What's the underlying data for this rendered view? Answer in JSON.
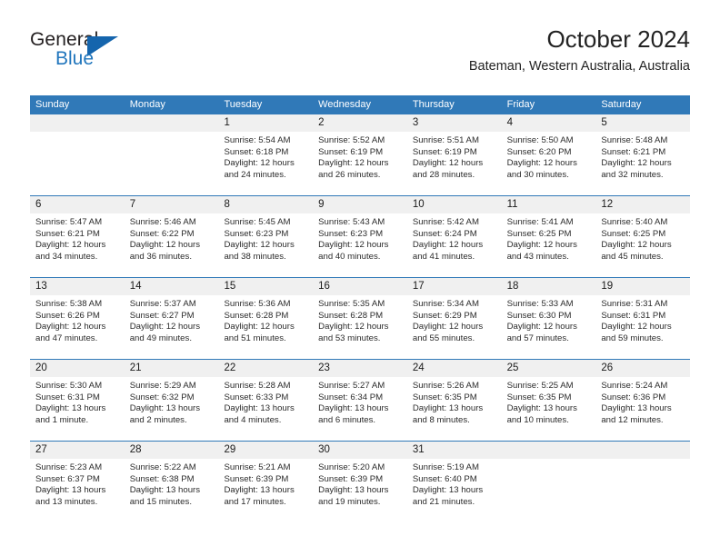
{
  "brand": {
    "name_part1": "General",
    "name_part2": "Blue",
    "triangle_color": "#1565ad",
    "blue_color": "#2176bd"
  },
  "header": {
    "title": "October 2024",
    "location": "Bateman, Western Australia, Australia"
  },
  "theme": {
    "header_blue": "#3079b8",
    "daynum_band": "#f0f0f0",
    "text": "#2b2b2b"
  },
  "weekdays": [
    "Sunday",
    "Monday",
    "Tuesday",
    "Wednesday",
    "Thursday",
    "Friday",
    "Saturday"
  ],
  "labels": {
    "sunrise_prefix": "Sunrise:",
    "sunset_prefix": "Sunset:",
    "daylight_prefix": "Daylight:"
  },
  "weeks": [
    [
      {
        "day": "",
        "empty": true
      },
      {
        "day": "",
        "empty": true
      },
      {
        "day": "1",
        "sunrise": "Sunrise: 5:54 AM",
        "sunset": "Sunset: 6:18 PM",
        "daylight_l1": "Daylight: 12 hours",
        "daylight_l2": "and 24 minutes."
      },
      {
        "day": "2",
        "sunrise": "Sunrise: 5:52 AM",
        "sunset": "Sunset: 6:19 PM",
        "daylight_l1": "Daylight: 12 hours",
        "daylight_l2": "and 26 minutes."
      },
      {
        "day": "3",
        "sunrise": "Sunrise: 5:51 AM",
        "sunset": "Sunset: 6:19 PM",
        "daylight_l1": "Daylight: 12 hours",
        "daylight_l2": "and 28 minutes."
      },
      {
        "day": "4",
        "sunrise": "Sunrise: 5:50 AM",
        "sunset": "Sunset: 6:20 PM",
        "daylight_l1": "Daylight: 12 hours",
        "daylight_l2": "and 30 minutes."
      },
      {
        "day": "5",
        "sunrise": "Sunrise: 5:48 AM",
        "sunset": "Sunset: 6:21 PM",
        "daylight_l1": "Daylight: 12 hours",
        "daylight_l2": "and 32 minutes."
      }
    ],
    [
      {
        "day": "6",
        "sunrise": "Sunrise: 5:47 AM",
        "sunset": "Sunset: 6:21 PM",
        "daylight_l1": "Daylight: 12 hours",
        "daylight_l2": "and 34 minutes."
      },
      {
        "day": "7",
        "sunrise": "Sunrise: 5:46 AM",
        "sunset": "Sunset: 6:22 PM",
        "daylight_l1": "Daylight: 12 hours",
        "daylight_l2": "and 36 minutes."
      },
      {
        "day": "8",
        "sunrise": "Sunrise: 5:45 AM",
        "sunset": "Sunset: 6:23 PM",
        "daylight_l1": "Daylight: 12 hours",
        "daylight_l2": "and 38 minutes."
      },
      {
        "day": "9",
        "sunrise": "Sunrise: 5:43 AM",
        "sunset": "Sunset: 6:23 PM",
        "daylight_l1": "Daylight: 12 hours",
        "daylight_l2": "and 40 minutes."
      },
      {
        "day": "10",
        "sunrise": "Sunrise: 5:42 AM",
        "sunset": "Sunset: 6:24 PM",
        "daylight_l1": "Daylight: 12 hours",
        "daylight_l2": "and 41 minutes."
      },
      {
        "day": "11",
        "sunrise": "Sunrise: 5:41 AM",
        "sunset": "Sunset: 6:25 PM",
        "daylight_l1": "Daylight: 12 hours",
        "daylight_l2": "and 43 minutes."
      },
      {
        "day": "12",
        "sunrise": "Sunrise: 5:40 AM",
        "sunset": "Sunset: 6:25 PM",
        "daylight_l1": "Daylight: 12 hours",
        "daylight_l2": "and 45 minutes."
      }
    ],
    [
      {
        "day": "13",
        "sunrise": "Sunrise: 5:38 AM",
        "sunset": "Sunset: 6:26 PM",
        "daylight_l1": "Daylight: 12 hours",
        "daylight_l2": "and 47 minutes."
      },
      {
        "day": "14",
        "sunrise": "Sunrise: 5:37 AM",
        "sunset": "Sunset: 6:27 PM",
        "daylight_l1": "Daylight: 12 hours",
        "daylight_l2": "and 49 minutes."
      },
      {
        "day": "15",
        "sunrise": "Sunrise: 5:36 AM",
        "sunset": "Sunset: 6:28 PM",
        "daylight_l1": "Daylight: 12 hours",
        "daylight_l2": "and 51 minutes."
      },
      {
        "day": "16",
        "sunrise": "Sunrise: 5:35 AM",
        "sunset": "Sunset: 6:28 PM",
        "daylight_l1": "Daylight: 12 hours",
        "daylight_l2": "and 53 minutes."
      },
      {
        "day": "17",
        "sunrise": "Sunrise: 5:34 AM",
        "sunset": "Sunset: 6:29 PM",
        "daylight_l1": "Daylight: 12 hours",
        "daylight_l2": "and 55 minutes."
      },
      {
        "day": "18",
        "sunrise": "Sunrise: 5:33 AM",
        "sunset": "Sunset: 6:30 PM",
        "daylight_l1": "Daylight: 12 hours",
        "daylight_l2": "and 57 minutes."
      },
      {
        "day": "19",
        "sunrise": "Sunrise: 5:31 AM",
        "sunset": "Sunset: 6:31 PM",
        "daylight_l1": "Daylight: 12 hours",
        "daylight_l2": "and 59 minutes."
      }
    ],
    [
      {
        "day": "20",
        "sunrise": "Sunrise: 5:30 AM",
        "sunset": "Sunset: 6:31 PM",
        "daylight_l1": "Daylight: 13 hours",
        "daylight_l2": "and 1 minute."
      },
      {
        "day": "21",
        "sunrise": "Sunrise: 5:29 AM",
        "sunset": "Sunset: 6:32 PM",
        "daylight_l1": "Daylight: 13 hours",
        "daylight_l2": "and 2 minutes."
      },
      {
        "day": "22",
        "sunrise": "Sunrise: 5:28 AM",
        "sunset": "Sunset: 6:33 PM",
        "daylight_l1": "Daylight: 13 hours",
        "daylight_l2": "and 4 minutes."
      },
      {
        "day": "23",
        "sunrise": "Sunrise: 5:27 AM",
        "sunset": "Sunset: 6:34 PM",
        "daylight_l1": "Daylight: 13 hours",
        "daylight_l2": "and 6 minutes."
      },
      {
        "day": "24",
        "sunrise": "Sunrise: 5:26 AM",
        "sunset": "Sunset: 6:35 PM",
        "daylight_l1": "Daylight: 13 hours",
        "daylight_l2": "and 8 minutes."
      },
      {
        "day": "25",
        "sunrise": "Sunrise: 5:25 AM",
        "sunset": "Sunset: 6:35 PM",
        "daylight_l1": "Daylight: 13 hours",
        "daylight_l2": "and 10 minutes."
      },
      {
        "day": "26",
        "sunrise": "Sunrise: 5:24 AM",
        "sunset": "Sunset: 6:36 PM",
        "daylight_l1": "Daylight: 13 hours",
        "daylight_l2": "and 12 minutes."
      }
    ],
    [
      {
        "day": "27",
        "sunrise": "Sunrise: 5:23 AM",
        "sunset": "Sunset: 6:37 PM",
        "daylight_l1": "Daylight: 13 hours",
        "daylight_l2": "and 13 minutes."
      },
      {
        "day": "28",
        "sunrise": "Sunrise: 5:22 AM",
        "sunset": "Sunset: 6:38 PM",
        "daylight_l1": "Daylight: 13 hours",
        "daylight_l2": "and 15 minutes."
      },
      {
        "day": "29",
        "sunrise": "Sunrise: 5:21 AM",
        "sunset": "Sunset: 6:39 PM",
        "daylight_l1": "Daylight: 13 hours",
        "daylight_l2": "and 17 minutes."
      },
      {
        "day": "30",
        "sunrise": "Sunrise: 5:20 AM",
        "sunset": "Sunset: 6:39 PM",
        "daylight_l1": "Daylight: 13 hours",
        "daylight_l2": "and 19 minutes."
      },
      {
        "day": "31",
        "sunrise": "Sunrise: 5:19 AM",
        "sunset": "Sunset: 6:40 PM",
        "daylight_l1": "Daylight: 13 hours",
        "daylight_l2": "and 21 minutes."
      },
      {
        "day": "",
        "empty": true
      },
      {
        "day": "",
        "empty": true
      }
    ]
  ]
}
